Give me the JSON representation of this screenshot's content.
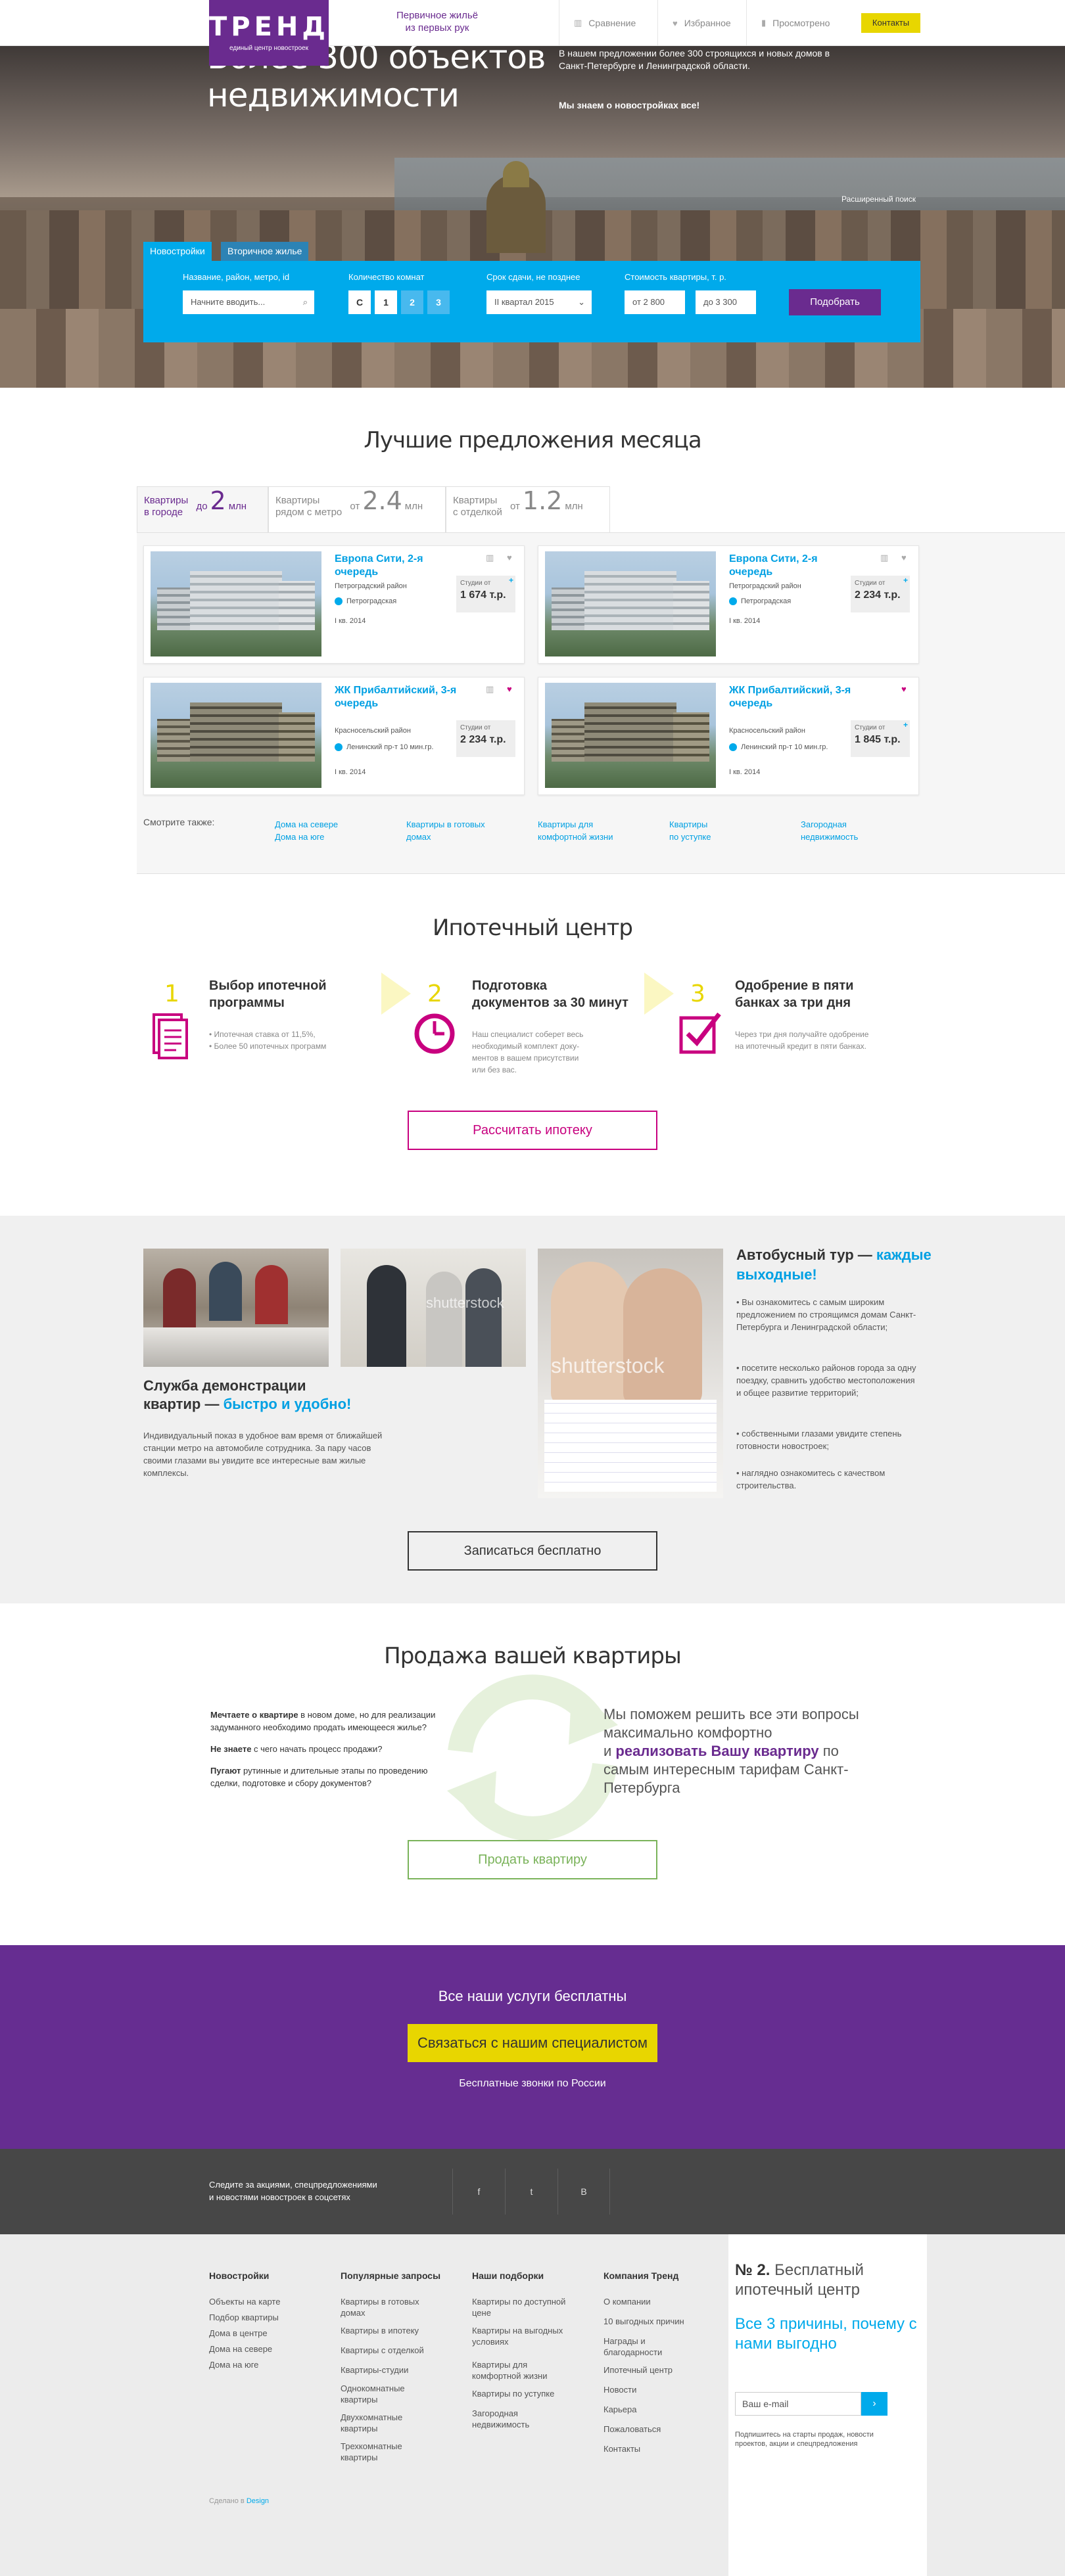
{
  "header": {
    "logo_text": "ТРЕНД",
    "logo_sub": "единый центр новостроек",
    "tagline_1": "Первичное жильё",
    "tagline_2": "из первых рук",
    "nav": [
      {
        "label": "Сравнение",
        "icon": "bar-chart-icon"
      },
      {
        "label": "Избранное",
        "icon": "heart-icon"
      },
      {
        "label": "Просмотрено",
        "icon": "bookmark-icon"
      }
    ],
    "contacts": "Контакты"
  },
  "hero": {
    "title_1": "Более 300 объектов",
    "title_2": "недвижимости",
    "text": "В нашем предложении более 300 строящихся и новых домов в Санкт-Петербурге и Ленинградской области.",
    "text_bold": "Мы знаем о новостройках все!",
    "advanced_search": "Расширенный поиск"
  },
  "search": {
    "tab_new": "Новостройки",
    "tab_secondary": "Вторичное жилье",
    "name_label": "Название, район, метро, id",
    "name_placeholder": "Начните вводить...",
    "rooms_label": "Количество комнат",
    "rooms": [
      "С",
      "1",
      "2",
      "3"
    ],
    "date_label": "Срок сдачи, не позднее",
    "date_value": "II квартал 2015",
    "price_label": "Стоимость квартиры, т. р.",
    "price_from": "от 2 800",
    "price_to": "до 3 300",
    "submit": "Подобрать"
  },
  "offers": {
    "title": "Лучшие предложения месяца",
    "tabs": [
      {
        "l1": "Квартиры",
        "l2": "в городе",
        "pre": "до",
        "big": "2",
        "unit": "млн"
      },
      {
        "l1": "Квартиры",
        "l2": "рядом с метро",
        "pre": "от",
        "big": "2.4",
        "unit": "млн"
      },
      {
        "l1": "Квартиры",
        "l2": "с отделкой",
        "pre": "от",
        "big": "1.2",
        "unit": "млн"
      }
    ],
    "cards": [
      {
        "title": "Европа Сити, 2-я очередь",
        "district": "Петроградский район",
        "metro": "Петроградская",
        "date": "I кв. 2014",
        "price_label": "Студии от",
        "price": "1 674 т.р."
      },
      {
        "title": "Европа Сити, 2-я очередь",
        "district": "Петроградский район",
        "metro": "Петроградская",
        "date": "I кв. 2014",
        "price_label": "Студии от",
        "price": "2 234 т.р."
      },
      {
        "title": "ЖК Прибалтийский, 3-я очередь",
        "district": "Красносельский район",
        "metro": "Ленинский пр-т 10 мин.гр.",
        "date": "I кв. 2014",
        "price_label": "Студии от",
        "price": "2 234 т.р."
      },
      {
        "title": "ЖК Прибалтийский, 3-я очередь",
        "district": "Красносельский район",
        "metro": "Ленинский пр-т 10 мин.гр.",
        "date": "I кв. 2014",
        "price_label": "Студии от",
        "price": "1 845 т.р."
      }
    ],
    "see_also": "Смотрите также:",
    "see_links": [
      [
        "Дома на севере",
        "Дома на юге"
      ],
      [
        "Квартиры в готовых",
        "домах"
      ],
      [
        "Квартиры для",
        "комфортной жизни"
      ],
      [
        "Квартиры",
        "по уступке"
      ],
      [
        "Загородная",
        "недвижимость"
      ]
    ]
  },
  "mortgage": {
    "title": "Ипотечный центр",
    "steps": [
      {
        "num": "1",
        "t1": "Выбор ипотечной",
        "t2": "программы",
        "d1": "• Ипотечная ставка от 11,5%,",
        "d2": "• Более 50 ипотечных программ",
        "d3": "",
        "d4": ""
      },
      {
        "num": "2",
        "t1": "Подготовка",
        "t2": "документов за 30 минут",
        "d1": "Наш специалист соберет весь",
        "d2": "необходимый комплект доку-",
        "d3": "ментов в вашем присутствии",
        "d4": "или без вас."
      },
      {
        "num": "3",
        "t1": "Одобрение в пяти",
        "t2": "банках за три дня",
        "d1": "Через три дня получайте одобрение",
        "d2": "на ипотечный кредит в пяти банках.",
        "d3": "",
        "d4": ""
      }
    ],
    "button": "Рассчитать ипотеку"
  },
  "demo": {
    "title_1": "Служба демонстрации",
    "title_2": "квартир — ",
    "title_accent": "быстро и удобно!",
    "desc": "Индивидуальный показ в удобное вам время от ближайшей станции метро на автомобиле сотрудника. За пару часов своими глазами вы увидите все интересные вам жилые комплексы.",
    "watermark": "shutterstock",
    "bus_title": "Автобусный тур — ",
    "bus_accent": "каждые выходные!",
    "bus_items": [
      "• Вы ознакомитесь с самым широким предложением по строящимся домам Санкт-Петербурга и Ленинградской области;",
      "• посетите несколько районов города за одну поездку, сравнить удобство местоположения и общее развитие территорий;",
      "• собственными глазами увидите степень готовности новостроек;",
      "• наглядно ознакомитесь с качеством строительства."
    ],
    "button": "Записаться бесплатно"
  },
  "sell": {
    "title": "Продажа вашей квартиры",
    "p1_bold": "Мечтаете о квартире",
    "p1": " в новом доме, но для реализации задуманного необходимо продать имеющееся жилье?",
    "p2_bold": "Не знаете",
    "p2": " с чего начать процесс продажи?",
    "p3_bold": "Пугают",
    "p3": " рутинные и длительные этапы по проведению сделки, подготовке и сбору документов?",
    "right_1": "Мы поможем решить все эти вопросы максимально комфортно",
    "right_and": "и ",
    "right_accent": "реализовать Вашу квартиру",
    "right_2": " по самым интересным тарифам Санкт-Петербурга",
    "button": "Продать квартиру"
  },
  "cta": {
    "title": "Все наши услуги бесплатны",
    "button": "Связаться с нашим специалистом",
    "sub": "Бесплатные звонки по России"
  },
  "social": {
    "text_1": "Следите за акциями, спецпредложениями",
    "text_2": "и новостями новостроек в соцсетях",
    "icons": [
      "f",
      "t",
      "B"
    ]
  },
  "footer": {
    "cols": [
      {
        "title": "Новостройки",
        "links": [
          "Объекты на карте",
          "Подбор квартиры",
          "Дома в центре",
          "Дома на севере",
          "Дома на юге"
        ]
      },
      {
        "title": "Популярные запросы",
        "links": [
          "Квартиры в готовых домах",
          "Квартиры в ипотеку",
          "Квартиры с отделкой",
          "Квартиры-студии",
          "Однокомнатные квартиры",
          "Двухкомнатные квартиры",
          "Трехкомнатные квартиры"
        ]
      },
      {
        "title": "Наши подборки",
        "links": [
          "Квартиры по доступной цене",
          "Квартиры на выгодных условиях",
          "Квартиры для комфортной жизни",
          "Квартиры по уступке",
          "Загородная недвижимость"
        ]
      },
      {
        "title": "Компания Тренд",
        "links": [
          "О компании",
          "10 выгодных причин",
          "Награды и благодарности",
          "Ипотечный центр",
          "Новости",
          "Карьера",
          "Пожаловаться",
          "Контакты"
        ]
      }
    ],
    "box_num": "№ 2.",
    "box_title": " Бесплатный ипотечный центр",
    "box_sub": "Все 3 причины, почему с нами выгодно",
    "email_placeholder": "Ваш e-mail",
    "note": "Подпишитесь на старты продаж, новости проектов, акции и спецпредложения",
    "made_in": "Сделано в ",
    "made_in_link": "Design"
  }
}
